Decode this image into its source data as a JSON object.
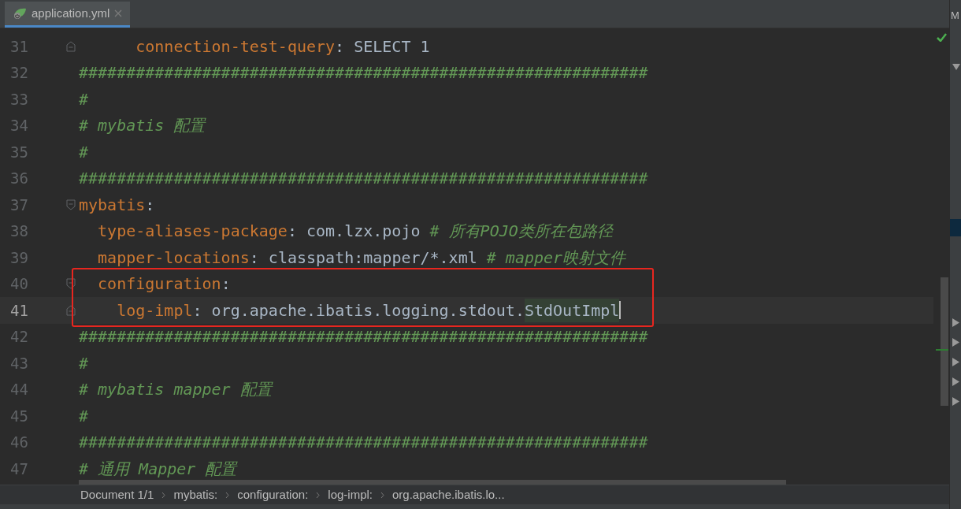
{
  "tab": {
    "label": "application.yml",
    "selected": true
  },
  "side_panel": {
    "title": "M"
  },
  "lines": [
    {
      "number": "31",
      "fold_end": true,
      "current": false,
      "boxed": false,
      "tokens": [
        {
          "kind": "key",
          "text": "      connection-test-query"
        },
        {
          "kind": "punct",
          "text": ": "
        },
        {
          "kind": "value",
          "text": "SELECT 1"
        }
      ]
    },
    {
      "number": "32",
      "current": false,
      "boxed": false,
      "tokens": [
        {
          "kind": "comment",
          "text": "############################################################"
        }
      ]
    },
    {
      "number": "33",
      "current": false,
      "boxed": false,
      "tokens": [
        {
          "kind": "comment",
          "text": "#"
        }
      ]
    },
    {
      "number": "34",
      "current": false,
      "boxed": false,
      "tokens": [
        {
          "kind": "comment",
          "text": "# mybatis 配置"
        }
      ]
    },
    {
      "number": "35",
      "current": false,
      "boxed": false,
      "tokens": [
        {
          "kind": "comment",
          "text": "#"
        }
      ]
    },
    {
      "number": "36",
      "current": false,
      "boxed": false,
      "tokens": [
        {
          "kind": "comment",
          "text": "############################################################"
        }
      ]
    },
    {
      "number": "37",
      "fold_start": true,
      "current": false,
      "boxed": false,
      "tokens": [
        {
          "kind": "key",
          "text": "mybatis"
        },
        {
          "kind": "punct",
          "text": ":"
        }
      ]
    },
    {
      "number": "38",
      "current": false,
      "boxed": false,
      "tokens": [
        {
          "kind": "key",
          "text": "  type-aliases-package"
        },
        {
          "kind": "punct",
          "text": ": "
        },
        {
          "kind": "value",
          "text": "com.lzx.pojo"
        },
        {
          "kind": "comment",
          "text": " # 所有POJO类所在包路径"
        }
      ]
    },
    {
      "number": "39",
      "current": false,
      "boxed": false,
      "tokens": [
        {
          "kind": "key",
          "text": "  mapper-locations"
        },
        {
          "kind": "punct",
          "text": ": "
        },
        {
          "kind": "value",
          "text": "classpath:mapper/*.xml"
        },
        {
          "kind": "comment",
          "text": " # mapper映射文件"
        }
      ]
    },
    {
      "number": "40",
      "fold_start": true,
      "current": false,
      "boxed": true,
      "tokens": [
        {
          "kind": "key",
          "text": "  configuration"
        },
        {
          "kind": "punct",
          "text": ":"
        }
      ]
    },
    {
      "number": "41",
      "fold_end": true,
      "current": true,
      "boxed": true,
      "caret": true,
      "tokens": [
        {
          "kind": "key",
          "text": "    log-impl"
        },
        {
          "kind": "punct",
          "text": ": "
        },
        {
          "kind": "value",
          "text": "org.apache.ibatis.logging.stdout."
        },
        {
          "kind": "match",
          "text": "StdOutImpl"
        }
      ]
    },
    {
      "number": "42",
      "current": false,
      "boxed": false,
      "tokens": [
        {
          "kind": "comment",
          "text": "############################################################"
        }
      ]
    },
    {
      "number": "43",
      "current": false,
      "boxed": false,
      "tokens": [
        {
          "kind": "comment",
          "text": "#"
        }
      ]
    },
    {
      "number": "44",
      "current": false,
      "boxed": false,
      "tokens": [
        {
          "kind": "comment",
          "text": "# mybatis mapper 配置"
        }
      ]
    },
    {
      "number": "45",
      "current": false,
      "boxed": false,
      "tokens": [
        {
          "kind": "comment",
          "text": "#"
        }
      ]
    },
    {
      "number": "46",
      "current": false,
      "boxed": false,
      "tokens": [
        {
          "kind": "comment",
          "text": "############################################################"
        }
      ]
    },
    {
      "number": "47",
      "current": false,
      "boxed": false,
      "tokens": [
        {
          "kind": "comment",
          "text": "# 通用 Mapper 配置"
        }
      ]
    }
  ],
  "breadcrumbs": [
    "Document 1/1",
    "mybatis:",
    "configuration:",
    "log-impl:",
    "org.apache.ibatis.lo..."
  ]
}
